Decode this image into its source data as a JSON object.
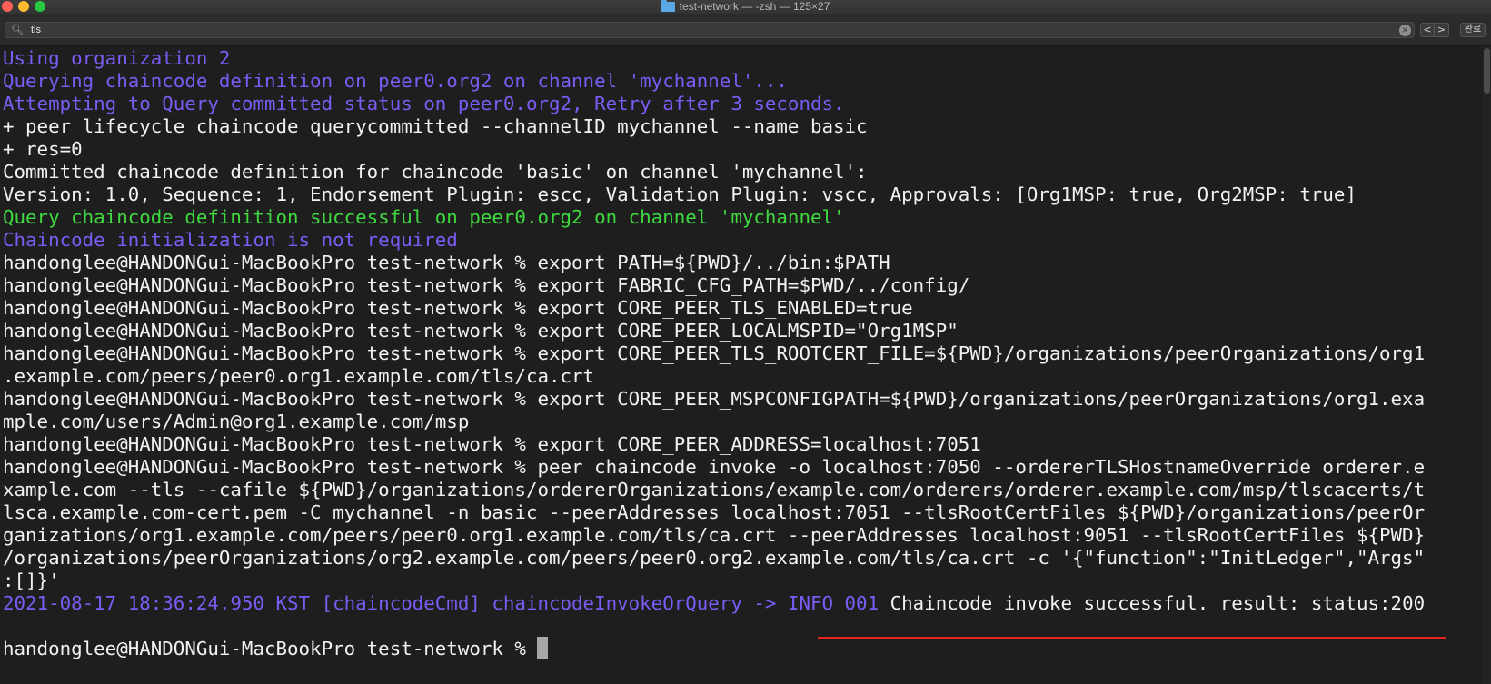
{
  "window": {
    "title": "test-network — -zsh — 125×27"
  },
  "findbar": {
    "value": "tls",
    "prev_label": "<",
    "next_label": ">",
    "done_label": "완료"
  },
  "terminal": {
    "lines": [
      "Using organization 2",
      "Querying chaincode definition on peer0.org2 on channel 'mychannel'...",
      "Attempting to Query committed status on peer0.org2, Retry after 3 seconds.",
      "+ peer lifecycle chaincode querycommitted --channelID mychannel --name basic",
      "+ res=0",
      "Committed chaincode definition for chaincode 'basic' on channel 'mychannel':",
      "Version: 1.0, Sequence: 1, Endorsement Plugin: escc, Validation Plugin: vscc, Approvals: [Org1MSP: true, Org2MSP: true]",
      "Query chaincode definition successful on peer0.org2 on channel 'mychannel'",
      "Chaincode initialization is not required",
      "handonglee@HANDONGui-MacBookPro test-network % export PATH=${PWD}/../bin:$PATH",
      "handonglee@HANDONGui-MacBookPro test-network % export FABRIC_CFG_PATH=$PWD/../config/",
      "handonglee@HANDONGui-MacBookPro test-network % export CORE_PEER_TLS_ENABLED=true",
      "handonglee@HANDONGui-MacBookPro test-network % export CORE_PEER_LOCALMSPID=\"Org1MSP\"",
      "handonglee@HANDONGui-MacBookPro test-network % export CORE_PEER_TLS_ROOTCERT_FILE=${PWD}/organizations/peerOrganizations/org1",
      ".example.com/peers/peer0.org1.example.com/tls/ca.crt",
      "handonglee@HANDONGui-MacBookPro test-network % export CORE_PEER_MSPCONFIGPATH=${PWD}/organizations/peerOrganizations/org1.exa",
      "mple.com/users/Admin@org1.example.com/msp",
      "handonglee@HANDONGui-MacBookPro test-network % export CORE_PEER_ADDRESS=localhost:7051",
      "handonglee@HANDONGui-MacBookPro test-network % peer chaincode invoke -o localhost:7050 --ordererTLSHostnameOverride orderer.e",
      "xample.com --tls --cafile ${PWD}/organizations/ordererOrganizations/example.com/orderers/orderer.example.com/msp/tlscacerts/t",
      "lsca.example.com-cert.pem -C mychannel -n basic --peerAddresses localhost:7051 --tlsRootCertFiles ${PWD}/organizations/peerOr",
      "ganizations/org1.example.com/peers/peer0.org1.example.com/tls/ca.crt --peerAddresses localhost:9051 --tlsRootCertFiles ${PWD}",
      "/organizations/peerOrganizations/org2.example.com/peers/peer0.org2.example.com/tls/ca.crt -c '{\"function\":\"InitLedger\",\"Args\"",
      ":[]}'"
    ],
    "log_prefix": "2021-08-17 18:36:24.950 KST [chaincodeCmd] chaincodeInvokeOrQuery -> INFO 001",
    "log_message": " Chaincode invoke successful. result: status:200",
    "prompt": "handonglee@HANDONGui-MacBookPro test-network % "
  },
  "colors": {
    "info": "#7b5cf5",
    "success": "#3ed93e",
    "text": "#f2f2f2",
    "highlight_underline": "#e8231d"
  }
}
